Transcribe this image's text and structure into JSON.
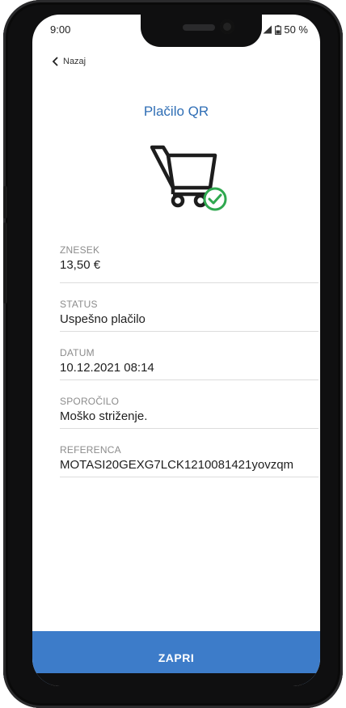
{
  "status_bar": {
    "time": "9:00",
    "battery": "50 %"
  },
  "header": {
    "back_label": "Nazaj",
    "title": "Plačilo QR"
  },
  "illustration": {
    "icon": "cart-check-icon",
    "accent": "#2fa84f"
  },
  "fields": [
    {
      "label": "ZNESEK",
      "value": "13,50 €"
    },
    {
      "label": "STATUS",
      "value": "Uspešno plačilo"
    },
    {
      "label": "DATUM",
      "value": "10.12.2021 08:14"
    },
    {
      "label": "SPOROČILO",
      "value": "Moško striženje."
    },
    {
      "label": "REFERENCA",
      "value": "MOTASI20GEXG7LCK1210081421yovzqm"
    }
  ],
  "footer": {
    "close_label": "ZAPRI"
  },
  "colors": {
    "title": "#2f6eb5",
    "button": "#3d7cc9"
  }
}
